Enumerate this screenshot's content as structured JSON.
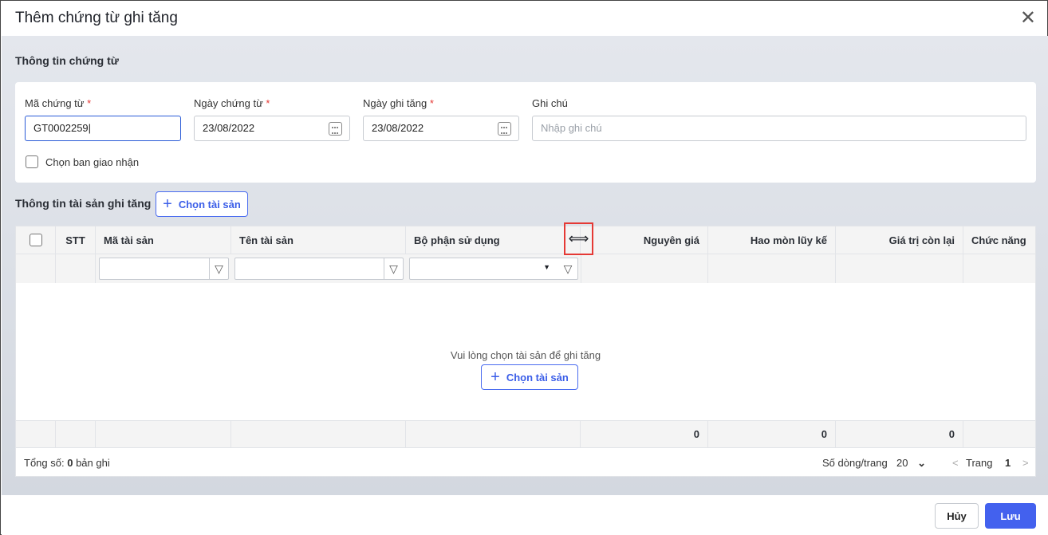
{
  "dialog": {
    "title": "Thêm chứng từ ghi tăng"
  },
  "voucher": {
    "section_title": "Thông tin chứng từ",
    "code_label": "Mã chứng từ",
    "code_value": "GT0002259",
    "date_label": "Ngày chứng từ",
    "date_value": "23/08/2022",
    "inc_date_label": "Ngày ghi tăng",
    "inc_date_value": "23/08/2022",
    "note_label": "Ghi chú",
    "note_placeholder": "Nhập ghi chú",
    "handover_label": "Chọn ban giao nhận",
    "required_mark": "*"
  },
  "assets": {
    "section_title": "Thông tin tài sản ghi tăng",
    "choose_label": "Chọn tài sản",
    "columns": [
      "STT",
      "Mã tài sản",
      "Tên tài sản",
      "Bộ phận sử dụng",
      "Nguyên giá",
      "Hao mòn lũy kế",
      "Giá trị còn lại",
      "Chức năng"
    ],
    "empty_text": "Vui lòng chọn tài sản để ghi tăng",
    "totals": {
      "original": "0",
      "depreciation": "0",
      "remaining": "0"
    }
  },
  "pager": {
    "total_prefix": "Tổng số:",
    "total_count": "0",
    "total_suffix": "bản ghi",
    "rows_label": "Số dòng/trang",
    "rows_value": "20",
    "page_label": "Trang",
    "page_value": "1"
  },
  "footer": {
    "cancel": "Hủy",
    "save": "Lưu"
  },
  "colors": {
    "primary": "#4361ee",
    "required": "#e53935"
  }
}
